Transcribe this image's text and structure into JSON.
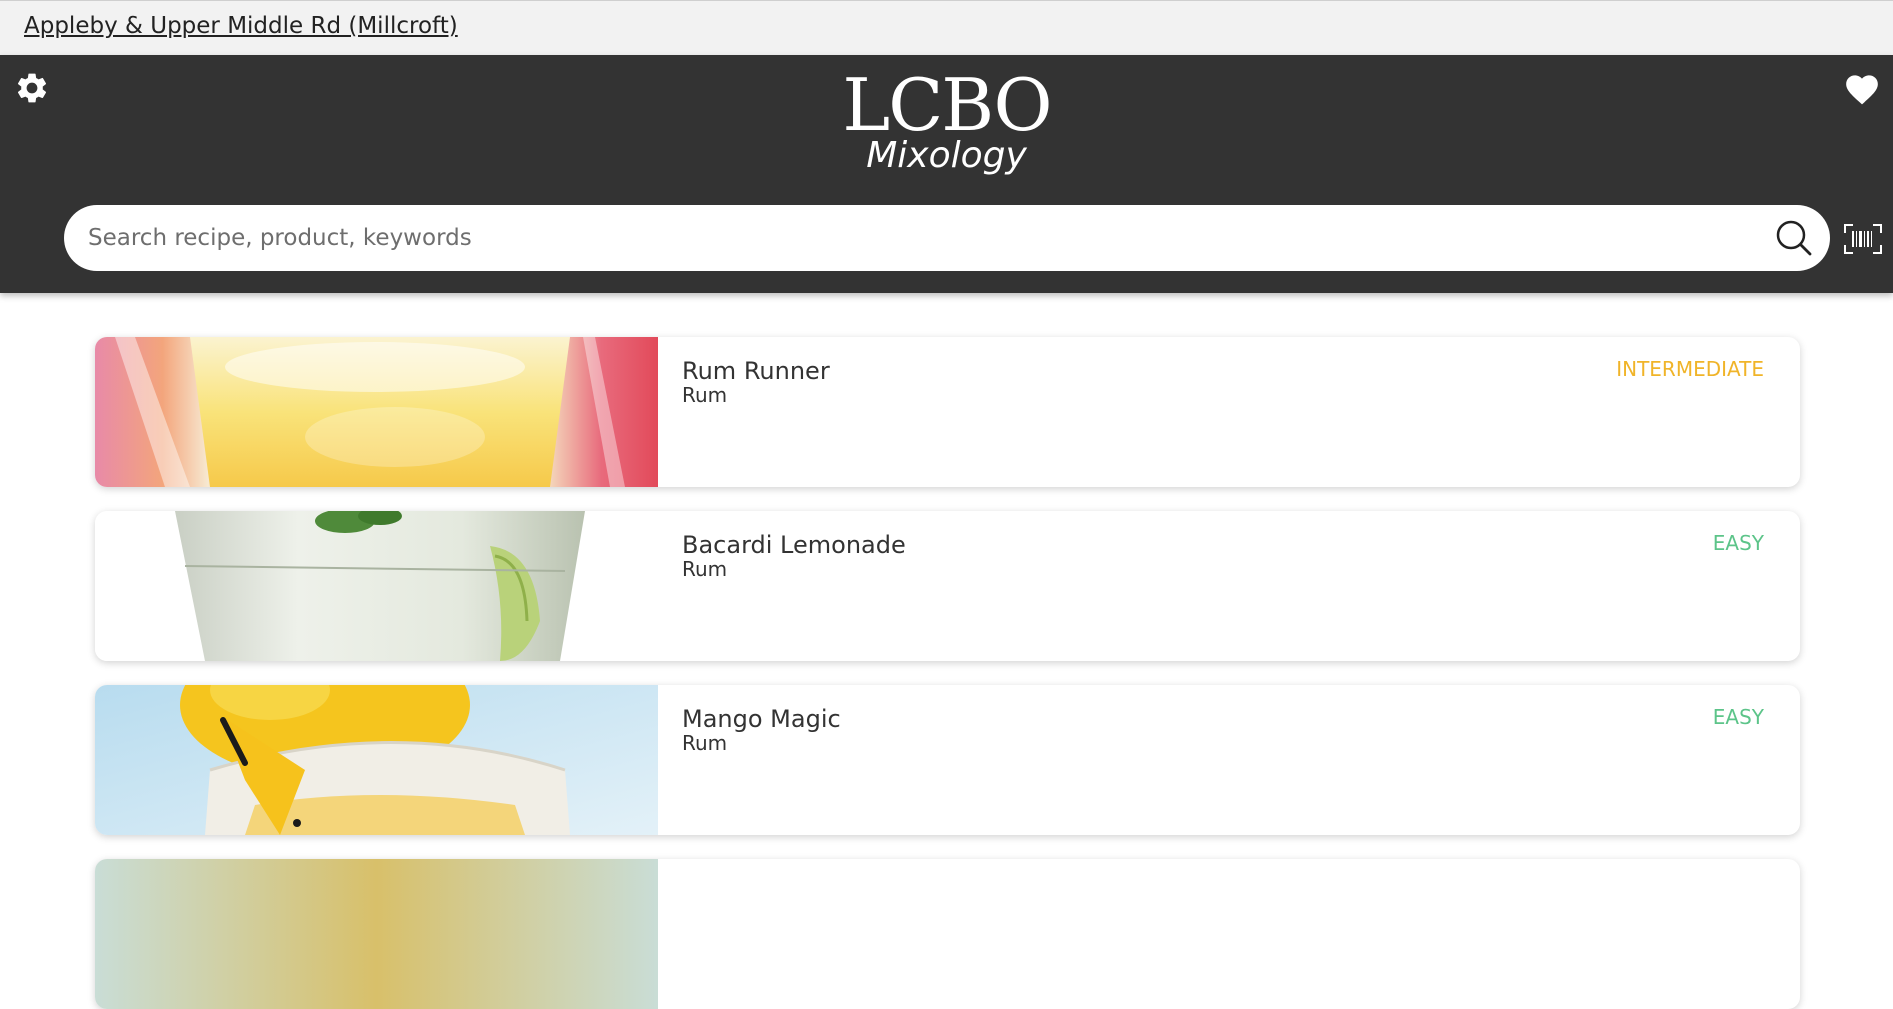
{
  "store": {
    "name": "Appleby & Upper Middle Rd (Millcroft)"
  },
  "header": {
    "logo_main": "LCBO",
    "logo_sub": "Mixology",
    "settings_icon": "gear-icon",
    "favorites_icon": "heart-icon",
    "barcode_icon": "barcode-scan-icon"
  },
  "search": {
    "placeholder": "Search recipe, product, keywords",
    "value": "",
    "icon": "search-icon"
  },
  "colors": {
    "header_bg": "#333333",
    "intermediate": "#f0b429",
    "easy": "#5cc489"
  },
  "recipes": [
    {
      "name": "Rum Runner",
      "category": "Rum",
      "difficulty": "INTERMEDIATE"
    },
    {
      "name": "Bacardi Lemonade",
      "category": "Rum",
      "difficulty": "EASY"
    },
    {
      "name": "Mango Magic",
      "category": "Rum",
      "difficulty": "EASY"
    }
  ]
}
